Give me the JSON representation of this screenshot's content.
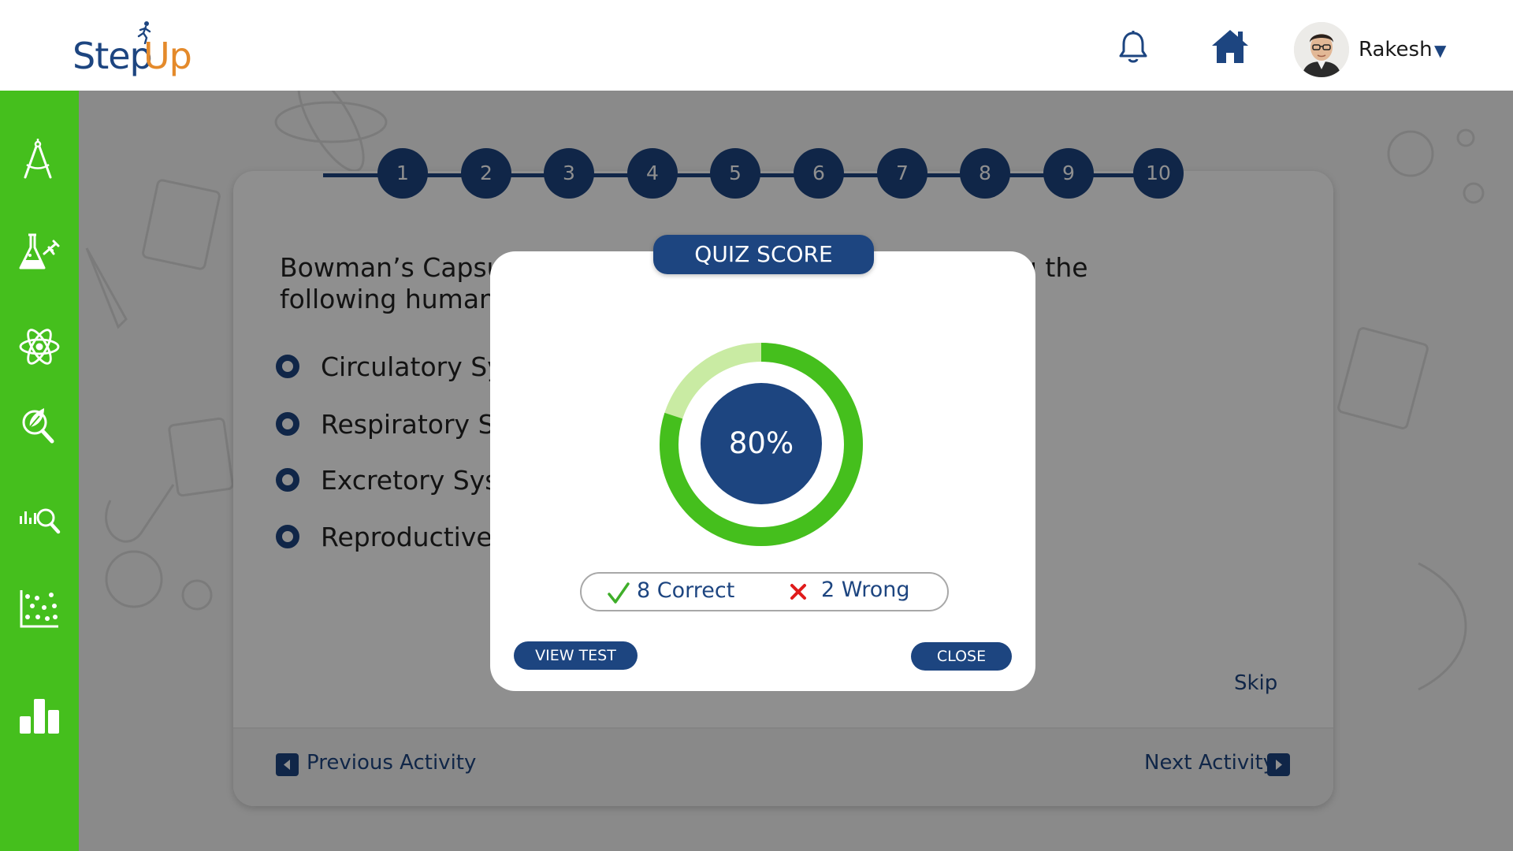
{
  "header": {
    "logo": {
      "part1": "Step",
      "part2": "Up"
    },
    "user": {
      "name": "Rakesh"
    }
  },
  "sidebar": {
    "items": [
      {
        "icon": "compass-icon"
      },
      {
        "icon": "flask-icon"
      },
      {
        "icon": "atom-icon"
      },
      {
        "icon": "leaf-magnifier-icon"
      },
      {
        "icon": "data-search-icon"
      },
      {
        "icon": "scatter-plot-icon"
      },
      {
        "icon": "bar-chart-icon"
      }
    ]
  },
  "quiz": {
    "steps": [
      "1",
      "2",
      "3",
      "4",
      "5",
      "6",
      "7",
      "8",
      "9",
      "10"
    ],
    "question": "Bowman’s Capsule is a part of the nephron. Which among the following human organ systems does it belong to?",
    "options": [
      "Circulatory System",
      "Respiratory System",
      "Excretory System",
      "Reproductive System"
    ],
    "skip": "Skip",
    "previous": "Previous Activity",
    "next": "Next Activity"
  },
  "modal": {
    "title": "QUIZ SCORE",
    "score_percent": "80%",
    "score_fraction": 0.8,
    "correct": "8 Correct",
    "wrong": "2 Wrong",
    "view_test": "VIEW TEST",
    "close": "CLOSE"
  },
  "colors": {
    "brand_blue": "#1d4580",
    "brand_orange": "#e48a2b",
    "sidebar_green": "#45bf1d",
    "ring_green": "#45bf1d",
    "ring_light_green": "#c9eba3",
    "wrong_red": "#e01b1b"
  }
}
